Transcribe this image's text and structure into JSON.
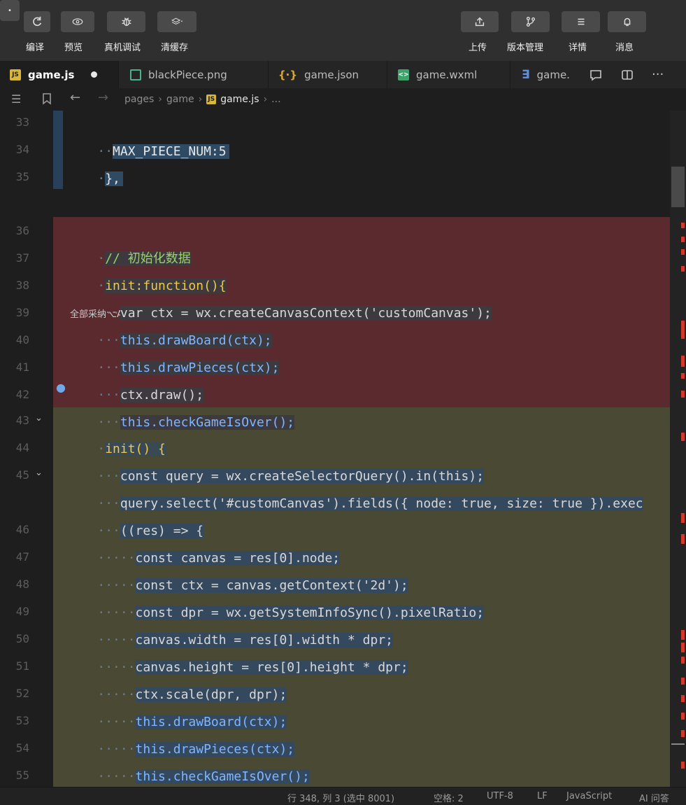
{
  "toolbar": {
    "left_buttons": [
      {
        "label": "编译",
        "icon": "refresh-icon"
      },
      {
        "label": "预览",
        "icon": "eye-icon"
      },
      {
        "label": "真机调试",
        "icon": "bug-icon"
      },
      {
        "label": "清缓存",
        "icon": "layers-icon"
      }
    ],
    "right_buttons": [
      {
        "label": "上传",
        "icon": "upload-icon"
      },
      {
        "label": "版本管理",
        "icon": "branch-icon"
      },
      {
        "label": "详情",
        "icon": "menu-icon"
      },
      {
        "label": "消息",
        "icon": "bell-icon"
      }
    ]
  },
  "tabs": [
    {
      "label": "game.js",
      "type": "js",
      "active": true,
      "modified": true
    },
    {
      "label": "blackPiece.png",
      "type": "png"
    },
    {
      "label": "game.json",
      "type": "json"
    },
    {
      "label": "game.wxml",
      "type": "wxml"
    },
    {
      "label": "game.",
      "type": "wxss"
    }
  ],
  "breadcrumb": {
    "items": [
      "pages",
      "game",
      "game.js",
      "..."
    ]
  },
  "codelens": "全部采纳⌥A | 全部放弃⌥X | 采纳 | 放弃",
  "lines": [
    {
      "n": "33",
      "code": "MAX_PIECE_NUM:5"
    },
    {
      "n": "34",
      "code": "},"
    },
    {
      "n": "35",
      "code": ""
    },
    {
      "n": "36",
      "code": "// 初始化数据"
    },
    {
      "n": "37",
      "code": "init:function(){"
    },
    {
      "n": "38",
      "code": "var ctx = wx.createCanvasContext('customCanvas');"
    },
    {
      "n": "39",
      "code": "this.drawBoard(ctx);"
    },
    {
      "n": "40",
      "code": "this.drawPieces(ctx);"
    },
    {
      "n": "41",
      "code": "ctx.draw();"
    },
    {
      "n": "42",
      "code": "this.checkGameIsOver();"
    },
    {
      "n": "43",
      "code": "init() {"
    },
    {
      "n": "44",
      "code": "const query = wx.createSelectorQuery().in(this);"
    },
    {
      "n": "45",
      "code": "query.select('#customCanvas').fields({ node: true, size: true }).exec"
    },
    {
      "n": "",
      "code": "((res) => {"
    },
    {
      "n": "46",
      "code": "const canvas = res[0].node;"
    },
    {
      "n": "47",
      "code": "const ctx = canvas.getContext('2d');"
    },
    {
      "n": "48",
      "code": "const dpr = wx.getSystemInfoSync().pixelRatio;"
    },
    {
      "n": "49",
      "code": "canvas.width = res[0].width * dpr;"
    },
    {
      "n": "50",
      "code": "canvas.height = res[0].height * dpr;"
    },
    {
      "n": "51",
      "code": "ctx.scale(dpr, dpr);"
    },
    {
      "n": "52",
      "code": "this.drawBoard(ctx);"
    },
    {
      "n": "53",
      "code": "this.drawPieces(ctx);"
    },
    {
      "n": "54",
      "code": "this.checkGameIsOver();"
    },
    {
      "n": "55",
      "code": "});"
    }
  ],
  "statusbar": {
    "position": "行 348, 列 3 (选中 8001)",
    "spaces": "空格: 2",
    "encoding": "UTF-8",
    "eol": "LF",
    "language": "JavaScript",
    "ai": "AI 问答"
  },
  "colors": {
    "removed_bg": "#5a2a2e",
    "added_bg": "#4a4a34",
    "selection": "#34495e",
    "keyword": "#f2c744",
    "function": "#7fb6ff",
    "string": "#f08ad6"
  }
}
